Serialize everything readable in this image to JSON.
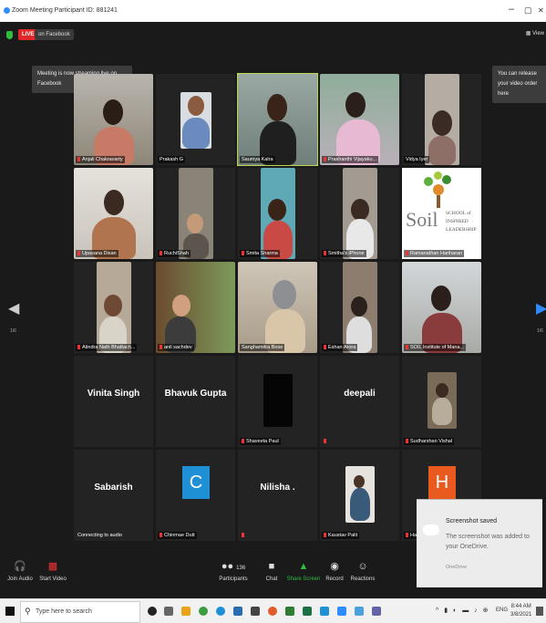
{
  "window": {
    "title": "Zoom Meeting Participant ID: 881241",
    "minimize": "–",
    "restore": "▢",
    "close": "✕"
  },
  "topbar": {
    "live": "LIVE",
    "live_on": "on Facebook",
    "view": "View"
  },
  "tooltips": {
    "streaming": "Meeting is now streaming live on Facebook",
    "release": "You can release your video order here"
  },
  "participants": [
    "Anjali Chakravarty",
    "Prakash G",
    "Saumya Kalra",
    "Prashanthi Vijayaku...",
    "Vidya Iyer",
    "Upasana Dixan",
    "RuchiShah",
    "Smita Sharma",
    "Smitha's iPhone",
    "Ramanathan Hariharan",
    "Atindra Nath Bhattach...",
    "anil sachdev",
    "Sanghamitra Bose",
    "Eshan Arora",
    "SOIL Institute of Mana...",
    "Vinita Singh",
    "Bhavuk Gupta",
    "Shaveeta Paul",
    "deepali",
    "Sudharshan Vishal",
    "Sabarish",
    "Chinmae Dutt",
    "Nilisha .",
    "Kaustav Palit",
    "Ha"
  ],
  "tiles_text": {
    "vinita": "Vinita Singh",
    "bhavuk": "Bhavuk Gupta",
    "deepali": "deepali",
    "sabarish": "Sabarish",
    "sabarish_status": "Connecting to audio",
    "chinmae_avatar": "C",
    "nilisha": "Nilisha .",
    "ha_avatar": "H"
  },
  "soil_logo": {
    "soil": "Soil",
    "school": "SCHOOL of",
    "inspired": "INSPIRED",
    "leadership": "LEADERSHIP"
  },
  "page_left": "1/6",
  "page_right": "1/6",
  "toolbar": {
    "join_audio": "Join Audio",
    "start_video": "Start Video",
    "participants": "Participants",
    "participants_count": "136",
    "chat": "Chat",
    "share_screen": "Share Screen",
    "record": "Record",
    "reactions": "Reactions"
  },
  "toast": {
    "title": "Screenshot saved",
    "body": "The screenshot was added to your OneDrive.",
    "footer": "OneDrive"
  },
  "taskbar": {
    "search_placeholder": "Type here to search",
    "lang": "ENG",
    "time": "8:44 AM",
    "date": "3/8/2021"
  }
}
